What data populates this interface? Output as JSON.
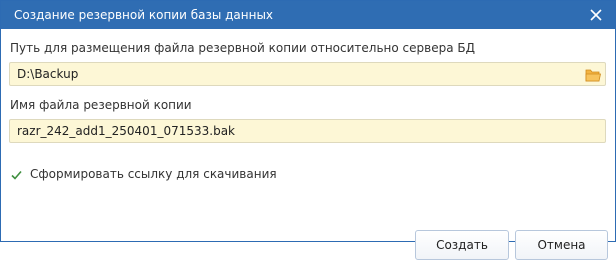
{
  "dialog": {
    "title": "Создание резервной копии базы данных",
    "close_icon": "close-icon"
  },
  "backup_path": {
    "label": "Путь для размещения файла резервной копии относительно сервера БД",
    "value": "D:\\Backup",
    "browse_icon": "folder-icon"
  },
  "backup_file": {
    "label": "Имя файла резервной копии",
    "value": "razr_242_add1_250401_071533.bak"
  },
  "download_link": {
    "label": "Сформировать ссылку для скачивания",
    "checked": true
  },
  "buttons": {
    "create": "Создать",
    "cancel": "Отмена"
  },
  "colors": {
    "titlebar": "#2f6db3",
    "field_background": "#fdf7d6",
    "folder_icon": "#f0a530"
  }
}
